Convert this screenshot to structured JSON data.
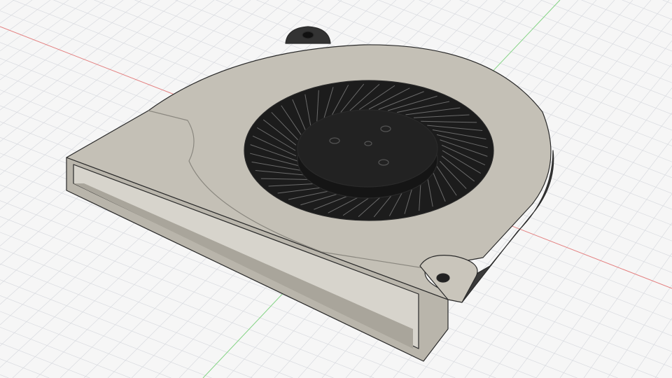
{
  "viewport": {
    "background_color": "#f6f6f6",
    "grid_color": "#d9dbe0",
    "x_axis_color": "#e07070",
    "y_axis_color": "#7ccf7c"
  },
  "model": {
    "body_color": "#c4c0b6",
    "edge_color": "#2a2a2a",
    "impeller_color": "#1c1c1c",
    "side_shadow_color": "#3a3a3a"
  }
}
